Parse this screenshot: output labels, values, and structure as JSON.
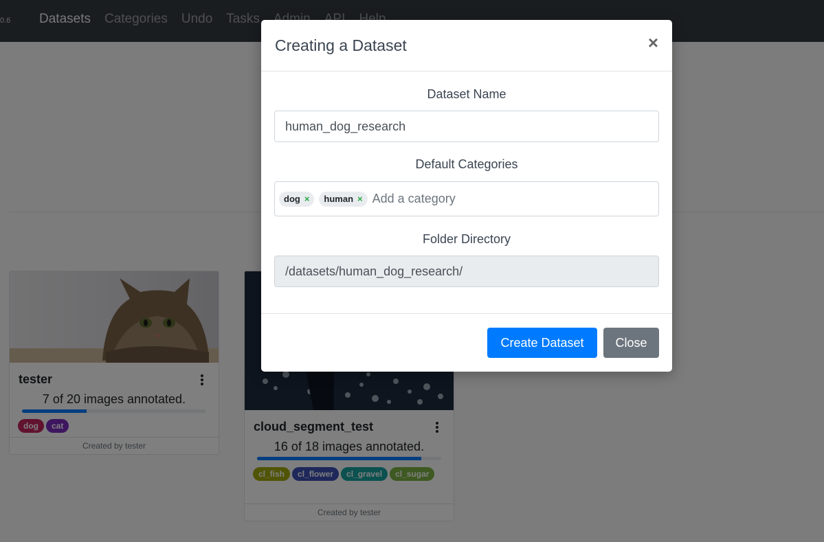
{
  "nav": {
    "version": "0.6",
    "links": [
      "Datasets",
      "Categories",
      "Undo",
      "Tasks",
      "Admin",
      "API",
      "Help"
    ]
  },
  "cards": [
    {
      "title": "tester",
      "annotated_text": "7 of 20 images annotated.",
      "progress_fraction": 0.35,
      "tags": [
        {
          "label": "dog",
          "color": "#c2255c"
        },
        {
          "label": "cat",
          "color": "#7b2cbf"
        }
      ],
      "footer": "Created by tester"
    },
    {
      "title": "cloud_segment_test",
      "annotated_text": "16 of 18 images annotated.",
      "progress_fraction": 0.89,
      "tags": [
        {
          "label": "cl_fish",
          "color": "#a0a80a"
        },
        {
          "label": "cl_flower",
          "color": "#3f51b5"
        },
        {
          "label": "cl_gravel",
          "color": "#17a2a0"
        },
        {
          "label": "cl_sugar",
          "color": "#7cb342"
        }
      ],
      "footer": "Created by tester"
    }
  ],
  "modal": {
    "title": "Creating a Dataset",
    "close_glyph": "×",
    "name_label": "Dataset Name",
    "name_value": "human_dog_research",
    "categories_label": "Default Categories",
    "categories": [
      "dog",
      "human"
    ],
    "chip_remove_glyph": "×",
    "categories_placeholder": "Add a category",
    "folder_label": "Folder Directory",
    "folder_value": "/datasets/human_dog_research/",
    "create_button": "Create Dataset",
    "close_button": "Close"
  },
  "colors": {
    "navbar": "#343a40",
    "primary": "#007bff",
    "secondary": "#6c757d",
    "chip_remove": "#28a745"
  }
}
